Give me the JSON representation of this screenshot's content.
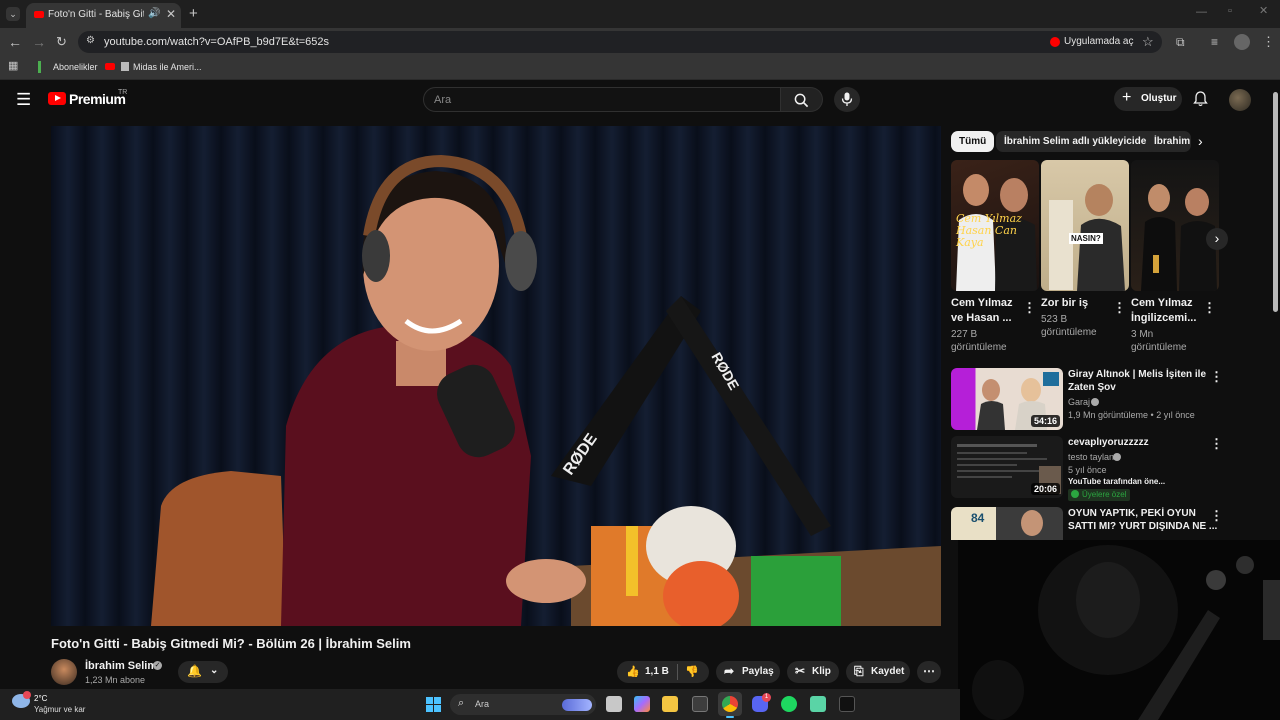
{
  "browser": {
    "tab_title": "Foto'n Gitti - Babiş Gitmedi",
    "url": "youtube.com/watch?v=OAfPB_b9d7E&t=652s",
    "open_in_app": "Uygulamada aç",
    "bookmarks": [
      "Abonelikler",
      "Midas ile Ameri..."
    ]
  },
  "youtube": {
    "logo": "Premium",
    "region": "TR",
    "search_placeholder": "Ara",
    "create_label": "Oluştur"
  },
  "video": {
    "title": "Foto'n Gitti - Babiş Gitmedi Mi? - Bölüm 26 | İbrahim Selim",
    "channel": "İbrahim Selim",
    "subscribers": "1,23 Mn abone",
    "likes": "1,1 B",
    "share_label": "Paylaş",
    "clip_label": "Klip",
    "save_label": "Kaydet",
    "mic_brand": "RØDE"
  },
  "chips": [
    "Tümü",
    "İbrahim Selim adlı yükleyiciden",
    "İbrahim"
  ],
  "shorts": [
    {
      "title1": "Cem Yılmaz",
      "title2": "ve Hasan ...",
      "views1": "227 B",
      "views2": "görüntüleme",
      "overlay": "Cem Yılmaz Hasan Can Kaya"
    },
    {
      "title1": "Zor bir iş",
      "title2": "",
      "views1": "523 B",
      "views2": "görüntüleme",
      "overlay": "NASIN?"
    },
    {
      "title1": "Cem Yılmaz",
      "title2": "İngilizcemi...",
      "views1": "3 Mn",
      "views2": "görüntüleme",
      "overlay": ""
    }
  ],
  "recommendations": [
    {
      "title1": "Giray Altınok | Melis İşiten ile",
      "title2": "Zaten Şov",
      "channel": "Garaj",
      "meta": "1,9 Mn görüntüleme • 2 yıl önce",
      "duration": "54:16"
    },
    {
      "title1": "cevaplıyoruzzzzz",
      "title2": "",
      "channel": "testo taylan",
      "meta": "5 yıl önce",
      "extra": "YouTube tarafından öne...",
      "badge": "Üyelere özel",
      "duration": "20:06"
    },
    {
      "title1": "OYUN YAPTIK, PEKİ OYUN",
      "title2": "SATTI MI? YURT DIŞINDA NE ...",
      "channel": "",
      "meta": "",
      "duration": "",
      "thumb_text": "84"
    }
  ],
  "taskbar": {
    "temperature": "2°C",
    "weather": "Yağmur ve kar",
    "search": "Ara",
    "discord_badge": "1"
  },
  "colors": {
    "yt_red": "#ff0000",
    "bg": "#0f0f0f",
    "chip": "#272727"
  }
}
